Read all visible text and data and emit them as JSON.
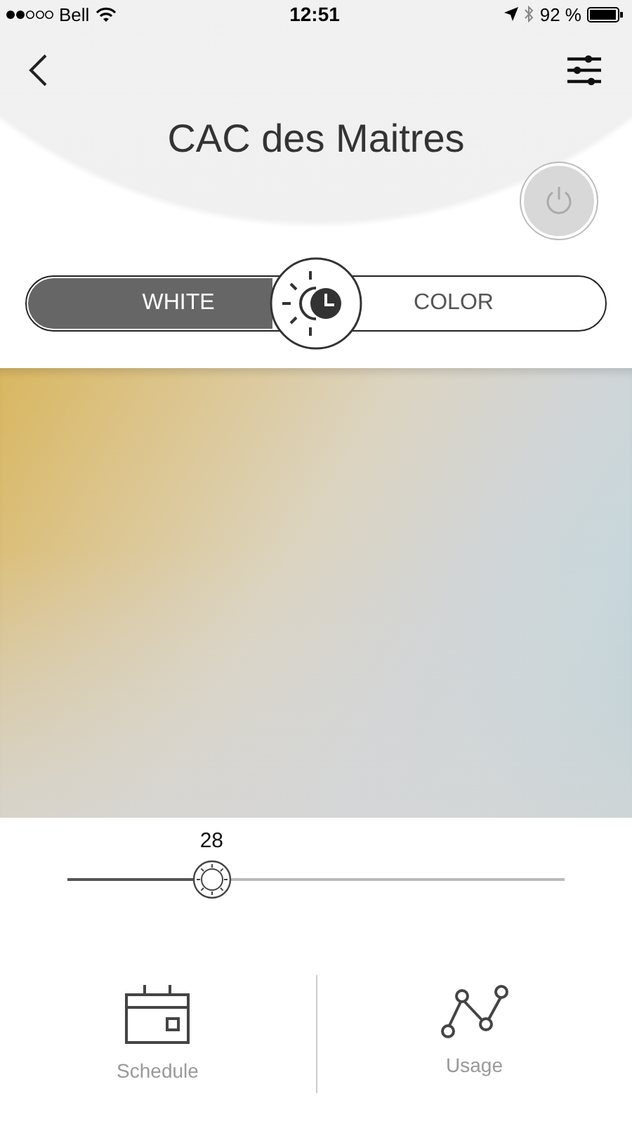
{
  "status_bar": {
    "carrier": "Bell",
    "time": "12:51",
    "battery": "92 %"
  },
  "header": {
    "title": "CAC des Maitres"
  },
  "power": {
    "on": false
  },
  "modes": [
    {
      "label": "WHITE",
      "selected": true
    },
    {
      "label": "COLOR",
      "selected": false
    }
  ],
  "slider": {
    "reading": "28",
    "level": 0.29
  },
  "bottom_tabs": [
    {
      "label": "Schedule",
      "kind": "calendar"
    },
    {
      "label": "Usage",
      "kind": "graph"
    }
  ]
}
